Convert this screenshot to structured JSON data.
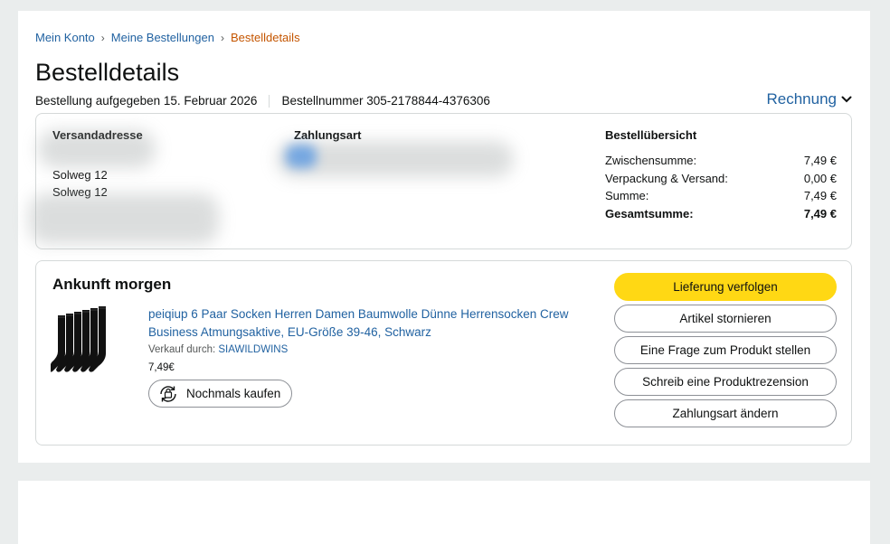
{
  "breadcrumb": {
    "account": "Mein Konto",
    "orders": "Meine Bestellungen",
    "current": "Bestelldetails"
  },
  "page": {
    "title": "Bestelldetails",
    "order_date": "Bestellung aufgegeben 15. Februar 2026",
    "order_number": "Bestellnummer 305-2178844-4376306",
    "invoice_label": "Rechnung"
  },
  "shipping": {
    "heading": "Versandadresse",
    "street1": "Solweg 12",
    "street2": "Solweg 12"
  },
  "payment": {
    "heading": "Zahlungsart"
  },
  "summary": {
    "title": "Bestellübersicht",
    "rows": [
      {
        "label": "Zwischensumme:",
        "value": "7,49 €"
      },
      {
        "label": "Verpackung & Versand:",
        "value": "0,00 €"
      },
      {
        "label": "Summe:",
        "value": "7,49 €"
      },
      {
        "label": "Gesamtsumme:",
        "value": "7,49 €"
      }
    ]
  },
  "shipment": {
    "arrival": "Ankunft morgen",
    "product_title": "peiqiup 6 Paar Socken Herren Damen Baumwolle Dünne Herrensocken Crew Business Atmungsaktive, EU-Größe 39-46, Schwarz",
    "seller_prefix": "Verkauf durch:",
    "seller_name": "SIAWILDWINS",
    "price": "7,49€",
    "rebuy_label": "Nochmals kaufen"
  },
  "actions": {
    "track": "Lieferung verfolgen",
    "cancel": "Artikel stornieren",
    "question": "Eine Frage zum Produkt stellen",
    "review": "Schreib eine Produktrezension",
    "change_payment": "Zahlungsart ändern"
  },
  "colors": {
    "link": "#2162a1",
    "breadcrumb_current": "#c45500",
    "primary_button": "#ffd814"
  }
}
